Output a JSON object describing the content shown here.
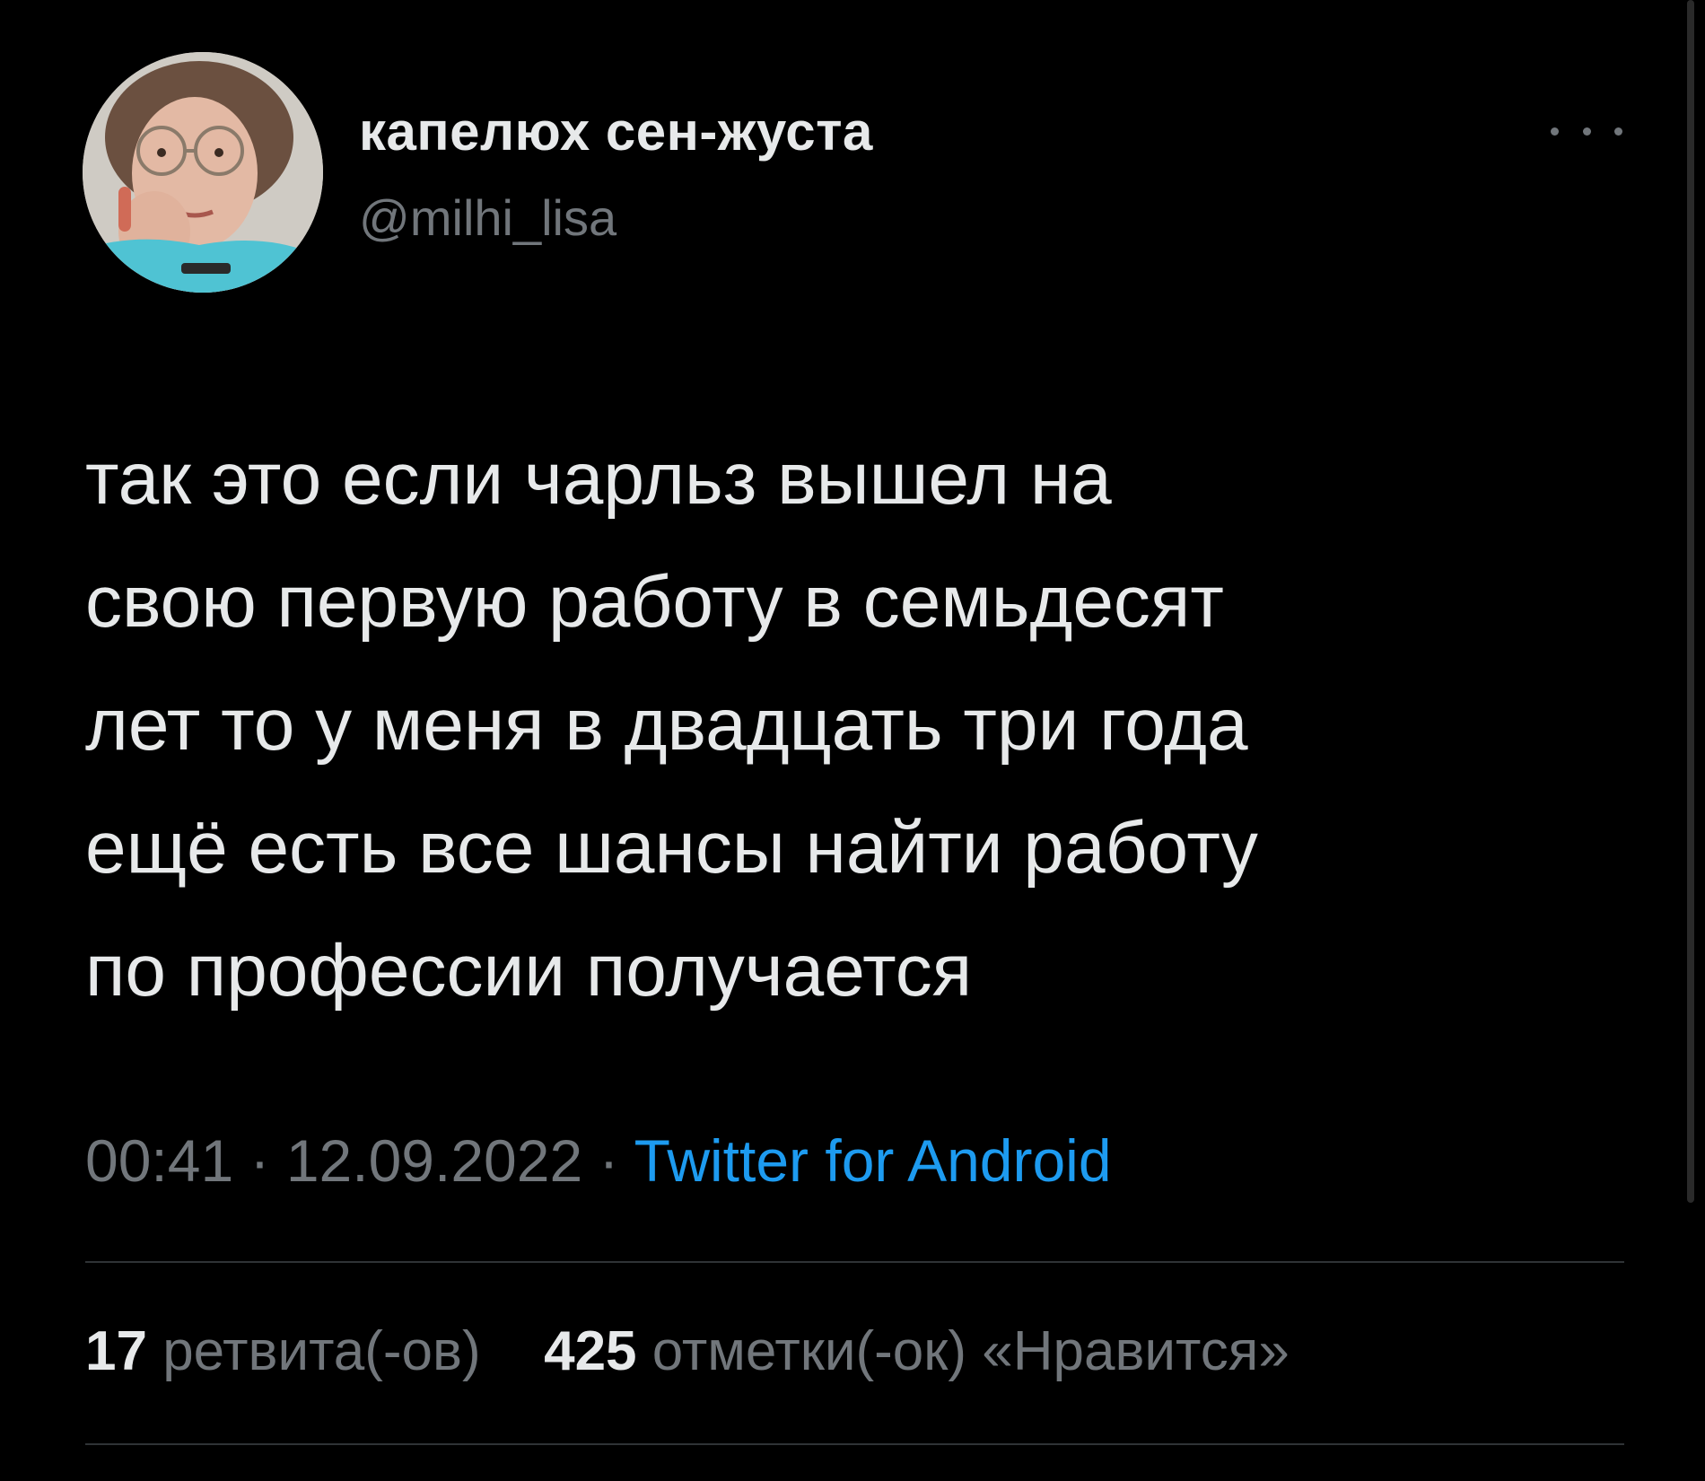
{
  "author": {
    "display_name": "капелюх сен-жуста",
    "handle": "@milhi_lisa"
  },
  "icons": {
    "more": "more-horizontal-icon",
    "avatar": "profile-photo"
  },
  "tweet": {
    "text": "так это если чарльз вышел на\nсвою первую работу в семьдесят\nлет то у меня в двадцать три года\nещё есть все шансы найти работу\nпо профессии получается"
  },
  "meta": {
    "time": "00:41",
    "separator": "·",
    "date": "12.09.2022",
    "source": "Twitter for Android"
  },
  "stats": {
    "retweets_count": "17",
    "retweets_label": "ретвита(-ов)",
    "likes_count": "425",
    "likes_label": "отметки(-ок) «Нравится»"
  },
  "colors": {
    "background": "#000000",
    "text": "#e7e9ea",
    "secondary": "#71767b",
    "link": "#1d9bf0",
    "divider": "#2f3336"
  }
}
